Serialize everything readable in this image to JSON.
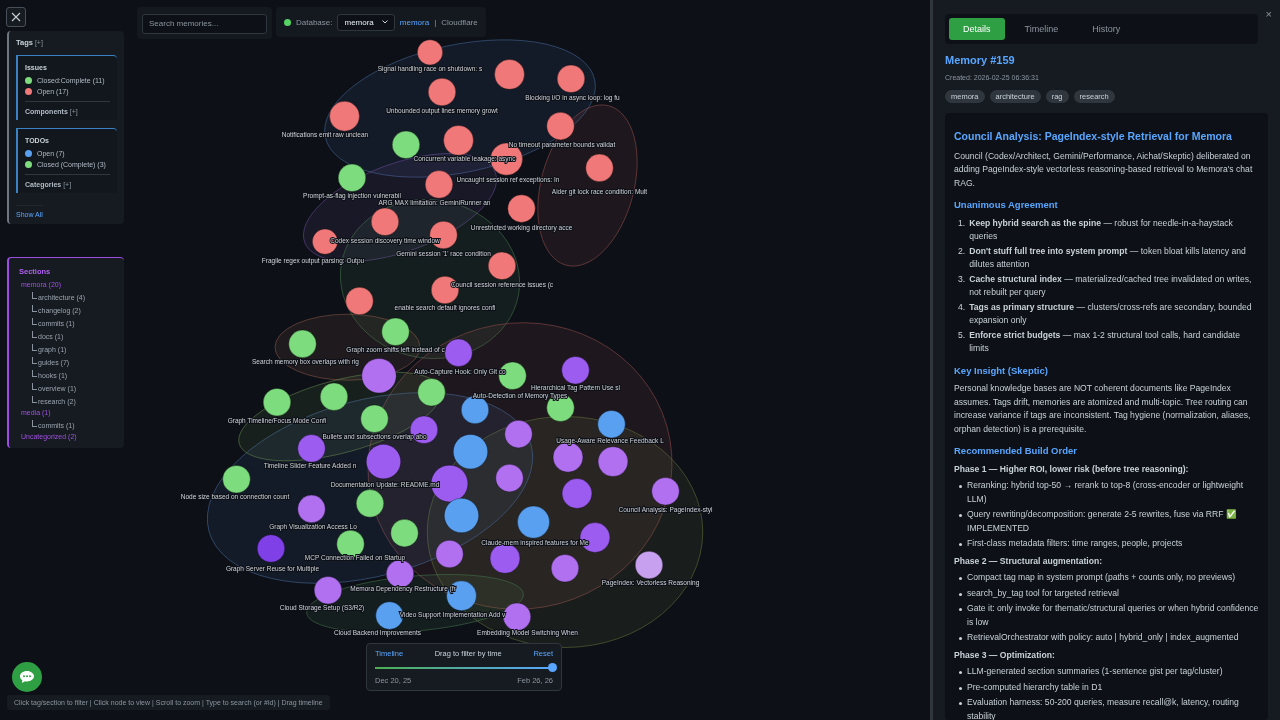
{
  "search": {
    "placeholder": "Search memories..."
  },
  "database": {
    "connected": true,
    "label": "Database:",
    "value": "memora",
    "link": "memora",
    "separator": "|",
    "provider": "Cloudflare"
  },
  "tags_panel": {
    "title": "Tags",
    "toggle": "[+]",
    "groups": [
      {
        "title": "Issues",
        "items": [
          {
            "label": "Closed:Complete (11)",
            "color": "#7ddc7d"
          },
          {
            "label": "Open (17)",
            "color": "#f07878"
          }
        ],
        "sub": {
          "title": "Components",
          "toggle": "[+]"
        }
      },
      {
        "title": "TODOs",
        "items": [
          {
            "label": "Open (7)",
            "color": "#5aa0f0"
          },
          {
            "label": "Closed (Complete) (3)",
            "color": "#7ddc7d"
          }
        ],
        "sub": {
          "title": "Categories",
          "toggle": "[+]"
        }
      }
    ],
    "show_all": "Show All"
  },
  "sections": {
    "title": "Sections",
    "items": [
      {
        "label": "memora (20)",
        "children": [
          {
            "label": "architecture (4)"
          },
          {
            "label": "changelog (2)"
          },
          {
            "label": "commits (1)"
          },
          {
            "label": "docs (1)"
          },
          {
            "label": "graph (1)"
          },
          {
            "label": "guides (7)"
          },
          {
            "label": "hooks (1)"
          },
          {
            "label": "overview (1)"
          },
          {
            "label": "research (2)"
          }
        ]
      },
      {
        "label": "media (1)",
        "children": [
          {
            "label": "commits (1)"
          }
        ]
      },
      {
        "label": "Uncategorized (2)"
      }
    ]
  },
  "graph": {
    "nodes": [
      {
        "color": "#f07878"
      },
      {
        "color": "#f07878"
      },
      {
        "color": "#f07878"
      },
      {
        "color": "#f07878"
      },
      {
        "color": "#f07878"
      },
      {
        "color": "#f07878"
      },
      {
        "color": "#f07878"
      },
      {
        "color": "#7ddc7d"
      },
      {
        "color": "#f07878"
      },
      {
        "color": "#f07878"
      },
      {
        "color": "#7ddc7d"
      },
      {
        "color": "#f07878"
      },
      {
        "color": "#f07878"
      },
      {
        "color": "#f07878"
      },
      {
        "color": "#f07878"
      },
      {
        "color": "#f07878"
      },
      {
        "color": "#f07878"
      },
      {
        "color": "#f07878"
      },
      {
        "color": "#f07878"
      },
      {
        "color": "#7ddc7d"
      },
      {
        "color": "#7ddc7d"
      },
      {
        "color": "#9d5cf0"
      },
      {
        "color": "#b070f0"
      },
      {
        "color": "#7ddc7d"
      },
      {
        "color": "#9d5cf0"
      },
      {
        "color": "#7ddc7d"
      },
      {
        "color": "#7ddc7d"
      },
      {
        "color": "#7ddc7d"
      },
      {
        "color": "#7ddc7d"
      },
      {
        "color": "#5aa0f0"
      },
      {
        "color": "#7ddc7d"
      },
      {
        "color": "#5aa0f0"
      },
      {
        "color": "#9d5cf0"
      },
      {
        "color": "#b070f0"
      },
      {
        "color": "#9d5cf0"
      },
      {
        "color": "#9d5cf0"
      },
      {
        "color": "#5aa0f0"
      },
      {
        "color": "#b070f0"
      },
      {
        "color": "#b070f0"
      },
      {
        "color": "#b070f0"
      },
      {
        "color": "#9d5cf0"
      },
      {
        "color": "#7ddc7d"
      },
      {
        "color": "#9d5cf0"
      },
      {
        "color": "#b070f0"
      },
      {
        "color": "#b070f0"
      },
      {
        "color": "#7ddc7d"
      },
      {
        "color": "#5aa0f0"
      },
      {
        "color": "#5aa0f0"
      },
      {
        "color": "#7ddc7d"
      },
      {
        "color": "#9d5cf0"
      },
      {
        "color": "#8040e8"
      },
      {
        "color": "#7ddc7d"
      },
      {
        "color": "#b070f0"
      },
      {
        "color": "#9d5cf0"
      },
      {
        "color": "#c8a0f0"
      },
      {
        "color": "#b070f0"
      },
      {
        "color": "#b070f0"
      },
      {
        "color": "#b070f0"
      },
      {
        "color": "#5aa0f0"
      },
      {
        "color": "#5aa0f0"
      },
      {
        "color": "#b070f0"
      }
    ],
    "labels": [
      "Signal handling race on shutdown: s",
      "Blocking I/O in async loop: log fu",
      "Unbounded output lines memory growt",
      "Notifications emit raw unclean",
      "No timeout parameter bounds validat",
      "Concurrent variable leakage: async",
      "Uncaught session ref exceptions: In",
      "Aider git lock race condition: Mult",
      "Prompt-as-flag injection vulnerabil",
      "ARG MAX limitation: GeminiRunner an",
      "Unrestricted working directory acce",
      "Codex session discovery time window",
      "Gemini session '1' race condition",
      "Fragile regex output parsing: Outpu",
      "Council session reference issues (c",
      "enable search default ignores confi",
      "Graph zoom shifts left instead of c",
      "Search memory box overlaps with rig",
      "Auto-Capture Hook: Only Git co",
      "Hierarchical Tag Pattern  Use sl",
      "Auto-Detection of Memory Types",
      "Graph Timeline/Focus Mode Confi",
      "Bullets and subsections overlap abo",
      "Usage-Aware Relevance Feedback L",
      "Timeline Slider Feature  Added n",
      "Documentation Update: README.md",
      "Node size based on connection count",
      "Council Analysis: PageIndex-styl",
      "Graph Visualization Access   Lo",
      "Claude-mem inspired features for Me",
      "MCP Connection Failed on Startup",
      "Graph Server Reuse for Multiple",
      "PageIndex: Vectorless Reasoning",
      "Memora Dependency Restructure (fr",
      "Cloud Storage Setup (S3/R2)",
      "Video Support Implementation  Add v",
      "Cloud Backend Improvements",
      "Embedding Model Switching  When"
    ]
  },
  "timeline": {
    "title": "Timeline",
    "hint": "Drag to filter by time",
    "reset": "Reset",
    "level": 1.0,
    "start": "Dec 20, 25",
    "end": "Feb 26, 26"
  },
  "help_bar": "Click tag/section to filter | Click node to view | Scroll to zoom | Type to search (or #id) | Drag timeline",
  "details": {
    "close": "×",
    "tabs": [
      {
        "label": "Details",
        "selected": true
      },
      {
        "label": "Timeline",
        "selected": false
      },
      {
        "label": "History",
        "selected": false
      }
    ],
    "title": "Memory #159",
    "created": "Created: 2026-02-25 06:36:31",
    "tags": [
      "memora",
      "architecture",
      "rag",
      "research"
    ],
    "heading": "Council Analysis: PageIndex-style Retrieval for Memora",
    "intro": "Council (Codex/Architect, Gemini/Performance, Aichat/Skeptic) deliberated on adding PageIndex-style vectorless reasoning-based retrieval to Memora's chat RAG.",
    "sections": [
      {
        "kind": "ordered",
        "heading": "Unanimous Agreement",
        "items": [
          {
            "number": "1.",
            "text": "**Keep hybrid search as the spine** — robust for needle-in-a-haystack queries"
          },
          {
            "number": "2.",
            "text": "**Don't stuff full tree into system prompt** — token bloat kills latency and dilutes attention"
          },
          {
            "number": "3.",
            "text": "**Cache structural index** — materialized/cached tree invalidated on writes, not rebuilt per query"
          },
          {
            "number": "4.",
            "text": "**Tags as primary structure** — clusters/cross-refs are secondary, bounded expansion only"
          },
          {
            "number": "5.",
            "text": "**Enforce strict budgets** — max 1-2 structural tool calls, hard candidate limits"
          }
        ]
      },
      {
        "kind": "paragraph",
        "heading": "Key Insight (Skeptic)",
        "text": "Personal knowledge bases are NOT coherent documents like PageIndex assumes. Tags drift, memories are atomized and multi-topic. Tree routing can increase variance if tags are inconsistent. Tag hygiene (normalization, aliases, orphan detection) is a prerequisite."
      },
      {
        "kind": "phases",
        "heading": "Recommended Build Order",
        "phases": [
          {
            "title": "Phase 1 — Higher ROI, lower risk (before tree reasoning):",
            "items": [
              "Reranking: hybrid top-50 → rerank to top-8 (cross-encoder or lightweight LLM)",
              "Query rewriting/decomposition: generate 2-5 rewrites, fuse via RRF ✅ IMPLEMENTED",
              "First-class metadata filters: time ranges, people, projects"
            ]
          },
          {
            "title": "Phase 2 — Structural augmentation:",
            "items": [
              "Compact tag map in system prompt (paths + counts only, no previews)",
              "search_by_tag tool for targeted retrieval",
              "Gate it: only invoke for thematic/structural queries or when hybrid confidence is low",
              "RetrievalOrchestrator with policy: auto | hybrid_only | index_augmented"
            ]
          },
          {
            "title": "Phase 3 — Optimization:",
            "items": [
              "LLM-generated section summaries (1-sentence gist per tag/cluster)",
              "Pre-computed hierarchy table in D1",
              "Evaluation harness: 50-200 queries, measure recall@k, latency, routing stability"
            ]
          }
        ]
      }
    ]
  }
}
